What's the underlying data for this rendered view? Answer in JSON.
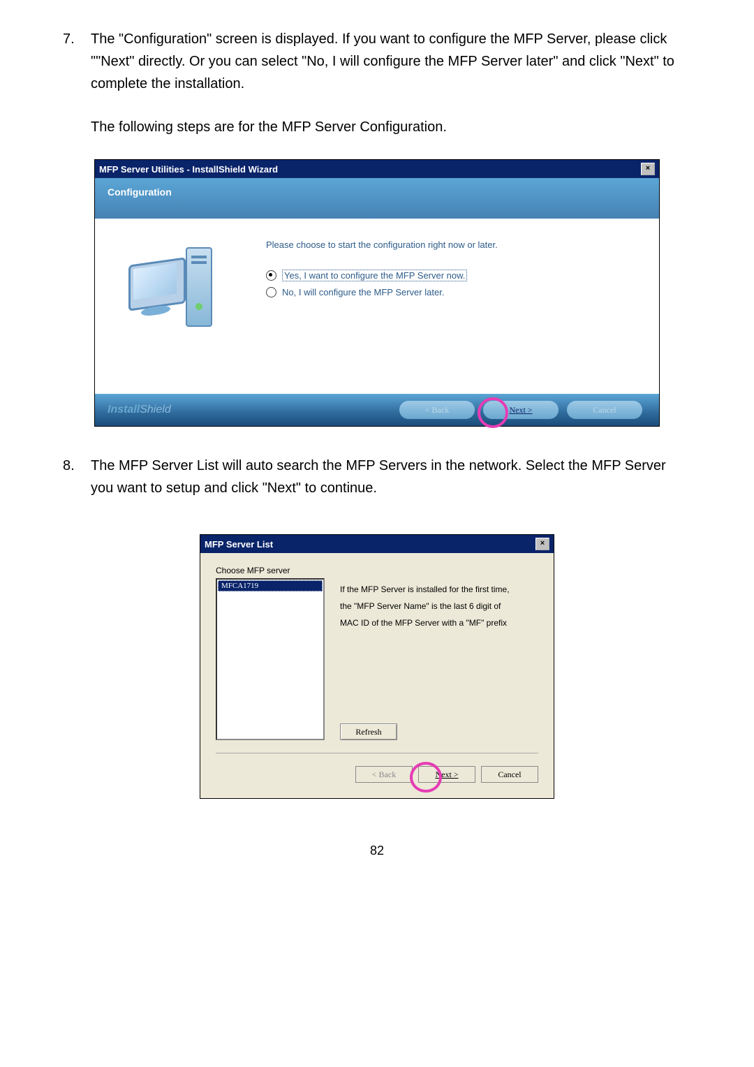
{
  "step7": {
    "num": "7.",
    "text": "The \"Configuration\" screen is displayed. If you want to configure the MFP Server, please click \"\"Next\" directly. Or you can select \"No, I will configure the MFP Server later\" and click \"Next\" to complete the installation.",
    "sub": "The following steps are for the MFP Server Configuration."
  },
  "dlg1": {
    "title": "MFP Server Utilities - InstallShield Wizard",
    "header": "Configuration",
    "prompt": "Please choose to start the configuration right now or later.",
    "opt1": "Yes, I want to configure the MFP Server now.",
    "opt2": "No, I will configure the MFP Server later.",
    "brand1": "Install",
    "brand2": "Shield",
    "back": "< Back",
    "next": "Next >",
    "cancel": "Cancel",
    "close": "×"
  },
  "step8": {
    "num": "8.",
    "text": "The MFP Server List will auto search the MFP Servers in the network. Select the MFP Server you want to setup and click \"Next\" to continue."
  },
  "dlg2": {
    "title": "MFP Server List",
    "label": "Choose MFP server",
    "item": "MFCA1719",
    "info1": "If the MFP Server is installed for the first time,",
    "info2": "the \"MFP Server Name\" is the last 6 digit of",
    "info3": "MAC ID of the MFP Server with a \"MF\" prefix",
    "refresh": "Refresh",
    "back": "< Back",
    "next": "Next >",
    "cancel": "Cancel",
    "close": "×"
  },
  "page": "82"
}
